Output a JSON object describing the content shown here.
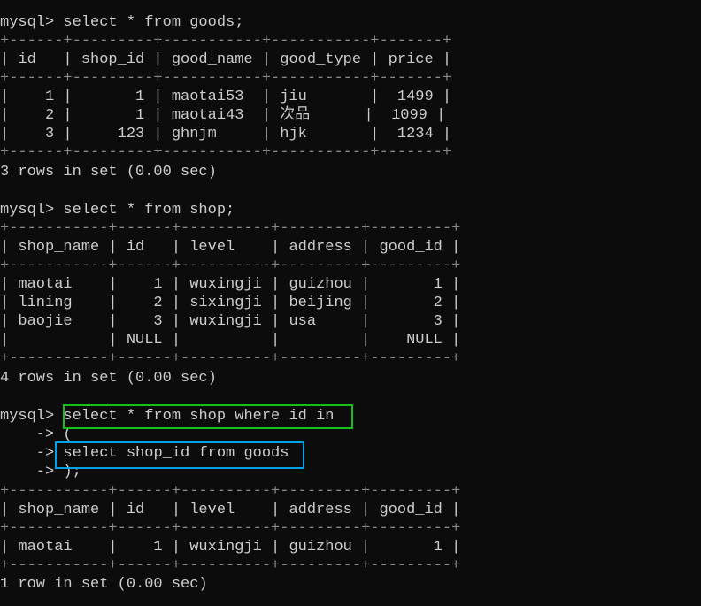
{
  "terminal": {
    "query1": {
      "command": "mysql> select * from goods;",
      "border": "+------+---------+-----------+-----------+-------+",
      "header": "| id   | shop_id | good_name | good_type | price |",
      "rows": [
        "|    1 |       1 | maotai53  | jiu       |  1499 |",
        "|    2 |       1 | maotai43  | 次品      |  1099 |",
        "|    3 |     123 | ghnjm     | hjk       |  1234 |"
      ],
      "status": "3 rows in set (0.00 sec)"
    },
    "query2": {
      "command": "mysql> select * from shop;",
      "border": "+-----------+------+----------+---------+---------+",
      "header": "| shop_name | id   | level    | address | good_id |",
      "rows": [
        "| maotai    |    1 | wuxingji | guizhou |       1 |",
        "| lining    |    2 | sixingji | beijing |       2 |",
        "| baojie    |    3 | wuxingji | usa     |       3 |",
        "|           | NULL |          |         |    NULL |"
      ],
      "status": "4 rows in set (0.00 sec)"
    },
    "query3": {
      "prompt": "mysql> ",
      "line1_text": "select * from shop where id in",
      "line2": "    -> (",
      "line3_prompt": "    -> ",
      "line3_text": "select shop_id from goods",
      "line4": "    -> );",
      "border": "+-----------+------+----------+---------+---------+",
      "header": "| shop_name | id   | level    | address | good_id |",
      "rows": [
        "| maotai    |    1 | wuxingji | guizhou |       1 |"
      ],
      "status": "1 row in set (0.00 sec)"
    }
  },
  "colors": {
    "background": "#0c0c0c",
    "text": "#cccccc",
    "green_highlight": "#14c11b",
    "blue_highlight": "#00a2e8"
  }
}
